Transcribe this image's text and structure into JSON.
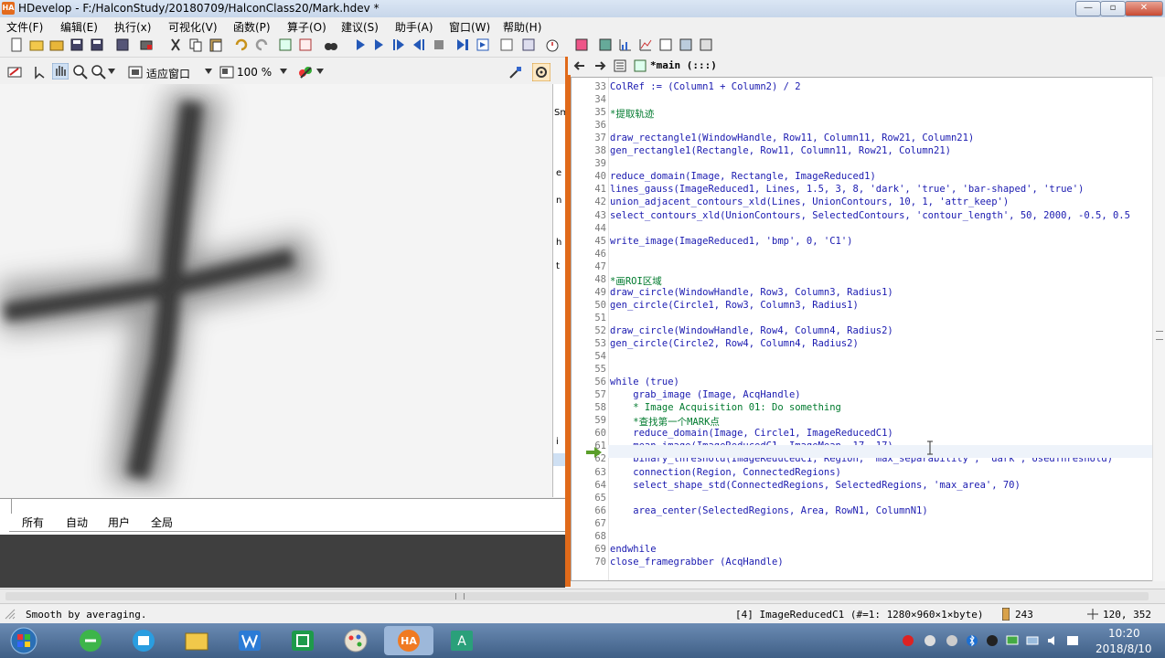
{
  "window": {
    "title": "HDevelop - F:/HalconStudy/20180709/HalconClass20/Mark.hdev *",
    "app_icon_text": "HA",
    "controls": {
      "minimize": "—",
      "maximize": "▫",
      "close": "✕"
    }
  },
  "menu": [
    "文件(F)",
    "编辑(E)",
    "执行(x)",
    "可视化(V)",
    "函数(P)",
    "算子(O)",
    "建议(S)",
    "助手(A)",
    "窗口(W)",
    "帮助(H)"
  ],
  "graphics_toolbar": {
    "fit_label": "适应窗口",
    "zoom_label": "100 %"
  },
  "side_letters": [
    "Sm",
    "e",
    "n",
    "h",
    "t",
    "i"
  ],
  "variable_tabs": [
    "所有",
    "自动",
    "用户",
    "全局"
  ],
  "editor": {
    "tab_title": "*main (:::)",
    "lines": [
      {
        "n": "33",
        "t": "ColRef := (Column1 + Column2) / 2",
        "c": false
      },
      {
        "n": "34",
        "t": "",
        "c": false
      },
      {
        "n": "35",
        "t": "*提取轨迹",
        "c": true
      },
      {
        "n": "36",
        "t": "",
        "c": false
      },
      {
        "n": "37",
        "t": "draw_rectangle1(WindowHandle, Row11, Column11, Row21, Column21)",
        "c": false
      },
      {
        "n": "38",
        "t": "gen_rectangle1(Rectangle, Row11, Column11, Row21, Column21)",
        "c": false
      },
      {
        "n": "39",
        "t": "",
        "c": false
      },
      {
        "n": "40",
        "t": "reduce_domain(Image, Rectangle, ImageReduced1)",
        "c": false
      },
      {
        "n": "41",
        "t": "lines_gauss(ImageReduced1, Lines, 1.5, 3, 8, 'dark', 'true', 'bar-shaped', 'true')",
        "c": false
      },
      {
        "n": "42",
        "t": "union_adjacent_contours_xld(Lines, UnionContours, 10, 1, 'attr_keep')",
        "c": false
      },
      {
        "n": "43",
        "t": "select_contours_xld(UnionContours, SelectedContours, 'contour_length', 50, 2000, -0.5, 0.5",
        "c": false
      },
      {
        "n": "44",
        "t": "",
        "c": false
      },
      {
        "n": "45",
        "t": "write_image(ImageReduced1, 'bmp', 0, 'C1')",
        "c": false
      },
      {
        "n": "46",
        "t": "",
        "c": false
      },
      {
        "n": "47",
        "t": "",
        "c": false
      },
      {
        "n": "48",
        "t": "*画ROI区域",
        "c": true
      },
      {
        "n": "49",
        "t": "draw_circle(WindowHandle, Row3, Column3, Radius1)",
        "c": false
      },
      {
        "n": "50",
        "t": "gen_circle(Circle1, Row3, Column3, Radius1)",
        "c": false
      },
      {
        "n": "51",
        "t": "",
        "c": false
      },
      {
        "n": "52",
        "t": "draw_circle(WindowHandle, Row4, Column4, Radius2)",
        "c": false
      },
      {
        "n": "53",
        "t": "gen_circle(Circle2, Row4, Column4, Radius2)",
        "c": false
      },
      {
        "n": "54",
        "t": "",
        "c": false
      },
      {
        "n": "55",
        "t": "",
        "c": false
      },
      {
        "n": "56",
        "t": "while (true)",
        "c": false
      },
      {
        "n": "57",
        "t": "    grab_image (Image, AcqHandle)",
        "c": false
      },
      {
        "n": "58",
        "t": "    * Image Acquisition 01: Do something",
        "c": true
      },
      {
        "n": "59",
        "t": "    *查找第一个MARK点",
        "c": true
      },
      {
        "n": "60",
        "t": "    reduce_domain(Image, Circle1, ImageReducedC1)",
        "c": false
      },
      {
        "n": "61",
        "t": "    mean_image(ImageReducedC1, ImageMean, 17, 17)",
        "c": false
      },
      {
        "n": "62",
        "t": "    binary_threshold(ImageReducedC1, Region, 'max_separability', 'dark', UsedThreshold)",
        "c": false
      },
      {
        "n": "63",
        "t": "    connection(Region, ConnectedRegions)",
        "c": false
      },
      {
        "n": "64",
        "t": "    select_shape_std(ConnectedRegions, SelectedRegions, 'max_area', 70)",
        "c": false
      },
      {
        "n": "65",
        "t": "",
        "c": false
      },
      {
        "n": "66",
        "t": "    area_center(SelectedRegions, Area, RowN1, ColumnN1)",
        "c": false
      },
      {
        "n": "67",
        "t": "",
        "c": false
      },
      {
        "n": "68",
        "t": "",
        "c": false
      },
      {
        "n": "69",
        "t": "endwhile",
        "c": false
      },
      {
        "n": "70",
        "t": "close_framegrabber (AcqHandle)",
        "c": false
      }
    ]
  },
  "status": {
    "message": "Smooth by averaging.",
    "image_info": "[4] ImageReducedC1 (#=1: 1280×960×1×byte)",
    "gray_value": "243",
    "coords": "120, 352"
  },
  "clock": {
    "time": "10:20",
    "date": "2018/8/10"
  },
  "colors": {
    "accent": "#e06a1a",
    "code": "#1a1ab0",
    "comment": "#007a2e"
  }
}
